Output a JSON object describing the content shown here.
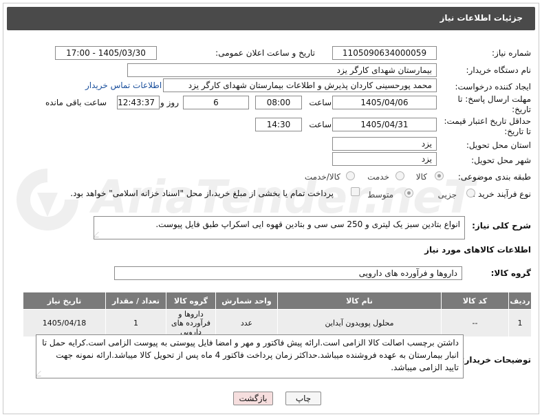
{
  "header": {
    "title": "جزئیات اطلاعات نیاز"
  },
  "fields": {
    "need_number_label": "شماره نیاز:",
    "need_number": "1105090634000059",
    "announce_label": "تاریخ و ساعت اعلان عمومی:",
    "announce_value": "1405/03/30 - 17:00",
    "buyer_org_label": "نام دستگاه خریدار:",
    "buyer_org": "بیمارستان شهدای کارگر یزد",
    "requester_label": "ایجاد کننده درخواست:",
    "requester": "محمد پورحسینی کاردان پذیرش و اطلاعات بیمارستان شهدای کارگر یزد",
    "buyer_contact_link": "اطلاعات تماس خریدار",
    "deadline_label_1": "مهلت ارسال پاسخ: تا",
    "deadline_label_2": "تاریخ:",
    "deadline_date": "1405/04/06",
    "time_label": "ساعت",
    "deadline_time": "08:00",
    "days_value": "6",
    "days_label": "روز و",
    "remaining_value": "12:43:37",
    "remaining_label": "ساعت باقی مانده",
    "min_validity_label_1": "حداقل تاریخ اعتبار قیمت:",
    "min_validity_label_2": "تا تاریخ:",
    "validity_date": "1405/04/31",
    "validity_time": "14:30",
    "province_label": "استان محل تحویل:",
    "province": "یزد",
    "city_label": "شهر محل تحویل:",
    "city": "یزد",
    "category_label": "طبقه بندی موضوعی:",
    "category_options": [
      "کالا",
      "خدمت",
      "کالا/خدمت"
    ],
    "process_label": "نوع فرآیند خرید :",
    "process_options": [
      "جزیی",
      "متوسط"
    ],
    "payment_text": "پرداخت تمام یا بخشی از مبلغ خرید،از محل \"اسناد خزانه اسلامی\" خواهد بود."
  },
  "description": {
    "label": "شرح کلی نیاز:",
    "text": "انواع بتادین سبز یک لیتری و 250 سی سی و بتادین قهوه ایی اسکراپ طبق فایل پیوست."
  },
  "goods_info": {
    "title": "اطلاعات کالاهای مورد نیاز",
    "group_label": "گروه کالا:",
    "group_value": "داروها و فرآورده های دارویی"
  },
  "table": {
    "headers": [
      "ردیف",
      "کد کالا",
      "نام کالا",
      "واحد شمارش",
      "گروه کالا",
      "تعداد / مقدار",
      "تاریخ نیاز"
    ],
    "rows": [
      [
        "1",
        "--",
        "محلول پوویدون آیداین",
        "عدد",
        "داروها و فرآورده های دارویی",
        "1",
        "1405/04/18"
      ]
    ]
  },
  "buyer_notes": {
    "label": "توضیحات خریدار:",
    "text": "داشتن برچسب اصالت کالا الزامی است.ارائه پیش فاکتور و مهر و امضا فایل پیوستی به پیوست الزامی است.کرایه حمل تا انبار بیمارستان به عهده فروشنده میباشد.حداکثر زمان پرداخت فاکتور 4 ماه پس از تحویل کالا میباشد.ارائه نمونه جهت تایید الزامی میباشد."
  },
  "buttons": {
    "print": "چاپ",
    "back": "بازگشت"
  },
  "watermark": {
    "text": "AriaTender.neT"
  }
}
